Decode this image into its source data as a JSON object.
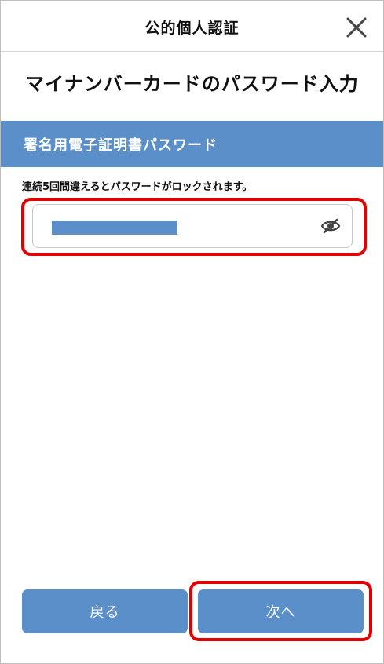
{
  "header": {
    "title": "公的個人認証",
    "close_icon": "close-icon"
  },
  "page": {
    "title": "マイナンバーカードのパスワード入力"
  },
  "section": {
    "label": "署名用電子証明書パスワード"
  },
  "password": {
    "notice": "連続5回間違えるとパスワードがロックされます。",
    "value_state": "masked",
    "toggle_icon": "eye-off-icon"
  },
  "footer": {
    "back_label": "戻る",
    "next_label": "次へ"
  },
  "colors": {
    "accent": "#5b8fc9",
    "highlight": "#e40000"
  }
}
